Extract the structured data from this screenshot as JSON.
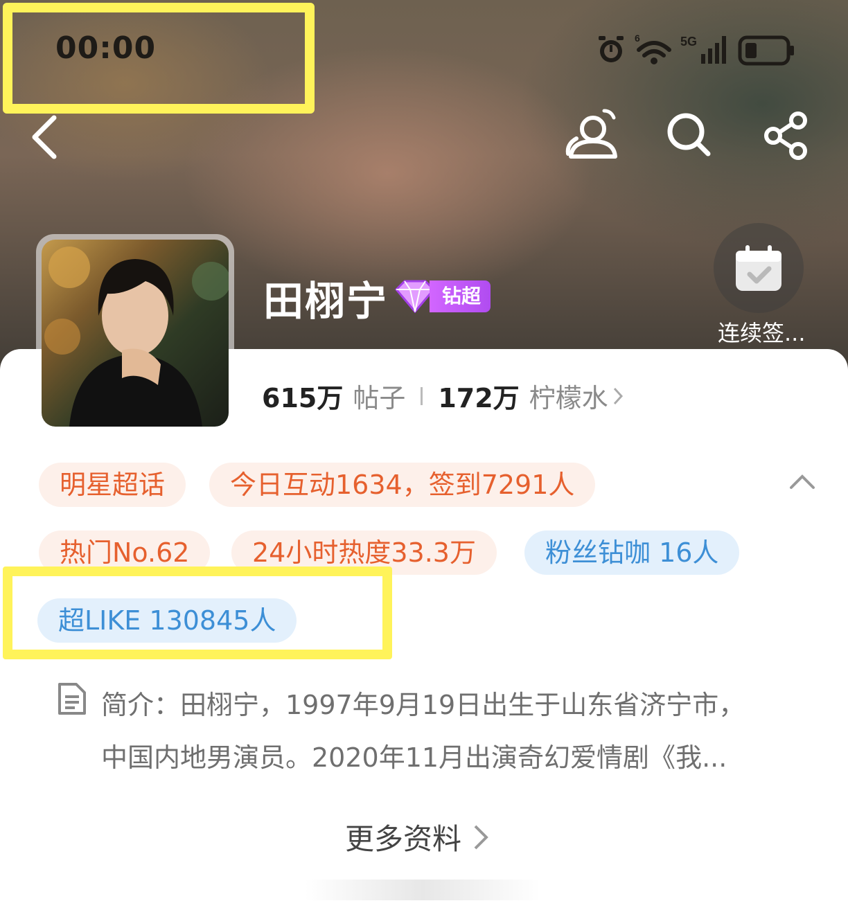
{
  "status_bar": {
    "time": "00:00"
  },
  "header": {
    "name": "田栩宁",
    "badge": "钻超",
    "checkin_label": "连续签..."
  },
  "stats": {
    "posts_count": "615万",
    "posts_label": "帖子",
    "lemon_count": "172万",
    "lemon_label": "柠檬水"
  },
  "tags": [
    "明星超话",
    "今日互动1634，签到7291人",
    "热门No.62",
    "24小时热度33.3万",
    "粉丝钻咖 16人",
    "超LIKE 130845人"
  ],
  "intro": {
    "line1": "简介：田栩宁，1997年9月19日出生于山东省济宁市，",
    "line2": "中国内地男演员。2020年11月出演奇幻爱情剧《我..."
  },
  "more_label": "更多资料",
  "colors": {
    "highlight": "#fff35a",
    "tag_orange": "#e6602e",
    "tag_blue": "#3d8fd6",
    "badge_purple": "#c05cf5"
  }
}
